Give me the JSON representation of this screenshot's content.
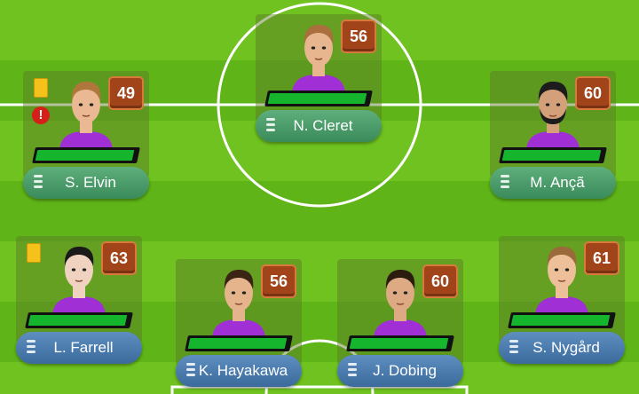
{
  "players": [
    {
      "id": "cleret",
      "name": "N. Cleret",
      "rating": "56",
      "stamina_pct": 0.97,
      "role": "midfield",
      "hair": "#a96f3c",
      "skin": "#e7b58e",
      "beard": false,
      "yellow_card": false,
      "injury": false
    },
    {
      "id": "elvin",
      "name": "S. Elvin",
      "rating": "49",
      "stamina_pct": 0.97,
      "role": "midfield",
      "hair": "#b0773d",
      "skin": "#eab892",
      "beard": false,
      "yellow_card": true,
      "injury": true
    },
    {
      "id": "anca",
      "name": "M. Ançã",
      "rating": "60",
      "stamina_pct": 0.97,
      "role": "midfield",
      "hair": "#1c1c1c",
      "skin": "#d3a07a",
      "beard": true,
      "yellow_card": false,
      "injury": false
    },
    {
      "id": "farrell",
      "name": "L. Farrell",
      "rating": "63",
      "stamina_pct": 0.97,
      "role": "defence",
      "hair": "#1a1a1a",
      "skin": "#f0d2c0",
      "beard": false,
      "yellow_card": true,
      "injury": false
    },
    {
      "id": "hayakawa",
      "name": "K. Hayakawa",
      "rating": "56",
      "stamina_pct": 0.97,
      "role": "defence",
      "hair": "#3a2515",
      "skin": "#e6b48c",
      "beard": false,
      "yellow_card": false,
      "injury": false
    },
    {
      "id": "dobing",
      "name": "J. Dobing",
      "rating": "60",
      "stamina_pct": 0.97,
      "role": "defence",
      "hair": "#2c1c10",
      "skin": "#ddaa84",
      "beard": false,
      "yellow_card": false,
      "injury": false
    },
    {
      "id": "nygard",
      "name": "S. Nygård",
      "rating": "61",
      "stamina_pct": 0.97,
      "role": "defence",
      "hair": "#9a6a3a",
      "skin": "#edc09a",
      "beard": false,
      "yellow_card": false,
      "injury": false
    }
  ],
  "colors": {
    "shirt": "#a12fd6",
    "stamina_fill": "#16b52e",
    "yellow_card": "#f4c21a",
    "injury": "#d5201a",
    "pitch_light": "#6fc21f",
    "pitch_dark": "#5fb417"
  },
  "icons": {
    "drag": "drag-handle-icon",
    "yellow_card": "yellow-card-icon",
    "injury": "exclamation-icon"
  }
}
